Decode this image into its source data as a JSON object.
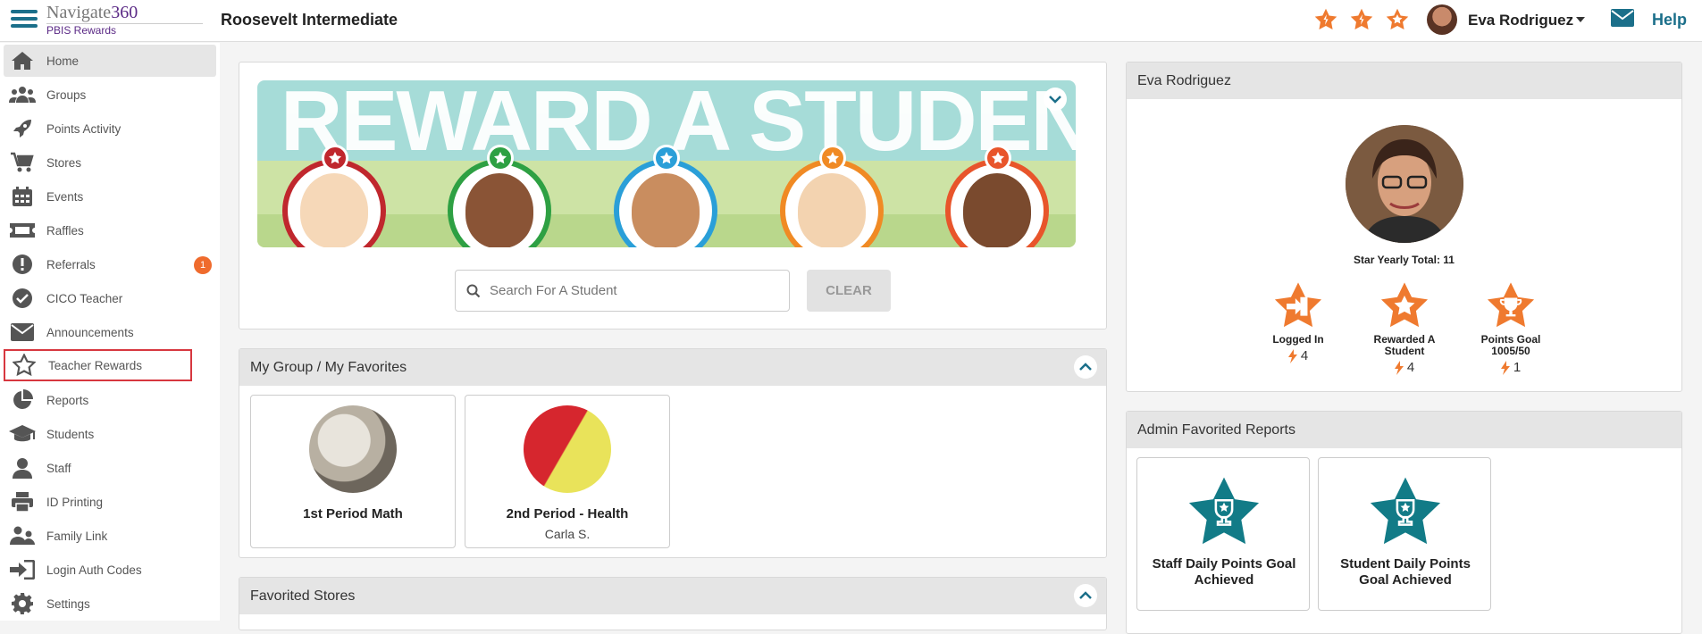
{
  "header": {
    "brand": "Navigate",
    "brand_num": "360",
    "brand_sub": "PBIS Rewards",
    "school": "Roosevelt Intermediate",
    "user_name": "Eva Rodriguez",
    "help": "Help"
  },
  "sidebar": {
    "items": [
      {
        "label": "Home",
        "icon": "home-icon"
      },
      {
        "label": "Groups",
        "icon": "groups-icon"
      },
      {
        "label": "Points Activity",
        "icon": "rocket-icon"
      },
      {
        "label": "Stores",
        "icon": "cart-icon"
      },
      {
        "label": "Events",
        "icon": "calendar-icon"
      },
      {
        "label": "Raffles",
        "icon": "ticket-icon"
      },
      {
        "label": "Referrals",
        "icon": "alert-icon",
        "badge": "1"
      },
      {
        "label": "CICO Teacher",
        "icon": "check-circle-icon"
      },
      {
        "label": "Announcements",
        "icon": "envelope-icon"
      },
      {
        "label": "Teacher Rewards",
        "icon": "star-outline-icon"
      },
      {
        "label": "Reports",
        "icon": "pie-chart-icon"
      },
      {
        "label": "Students",
        "icon": "graduation-cap-icon"
      },
      {
        "label": "Staff",
        "icon": "person-icon"
      },
      {
        "label": "ID Printing",
        "icon": "printer-icon"
      },
      {
        "label": "Family Link",
        "icon": "family-icon"
      },
      {
        "label": "Login Auth Codes",
        "icon": "login-icon"
      },
      {
        "label": "Settings",
        "icon": "gear-icon"
      }
    ]
  },
  "reward": {
    "banner_title": "REWARD A STUDENT",
    "search_placeholder": "Search For A Student",
    "clear_label": "CLEAR"
  },
  "groups_panel": {
    "title": "My Group / My Favorites",
    "cards": [
      {
        "title": "1st Period Math",
        "subtitle": ""
      },
      {
        "title": "2nd Period - Health",
        "subtitle": "Carla S."
      }
    ]
  },
  "stores_panel": {
    "title": "Favorited Stores"
  },
  "profile": {
    "name": "Eva Rodriguez",
    "total": "Star Yearly Total: 11",
    "badges": [
      {
        "label": "Logged In",
        "count": "4"
      },
      {
        "label": "Rewarded A Student",
        "count": "4"
      },
      {
        "label": "Points Goal 1005/50",
        "count": "1"
      }
    ]
  },
  "reports_panel": {
    "title": "Admin Favorited Reports",
    "cards": [
      {
        "title": "Staff Daily Points Goal Achieved"
      },
      {
        "title": "Student Daily Points Goal Achieved"
      }
    ]
  },
  "colors": {
    "accent": "#1b6f8a",
    "orange": "#ef7a2f",
    "teal": "#127b87",
    "highlight": "#d7373f"
  }
}
